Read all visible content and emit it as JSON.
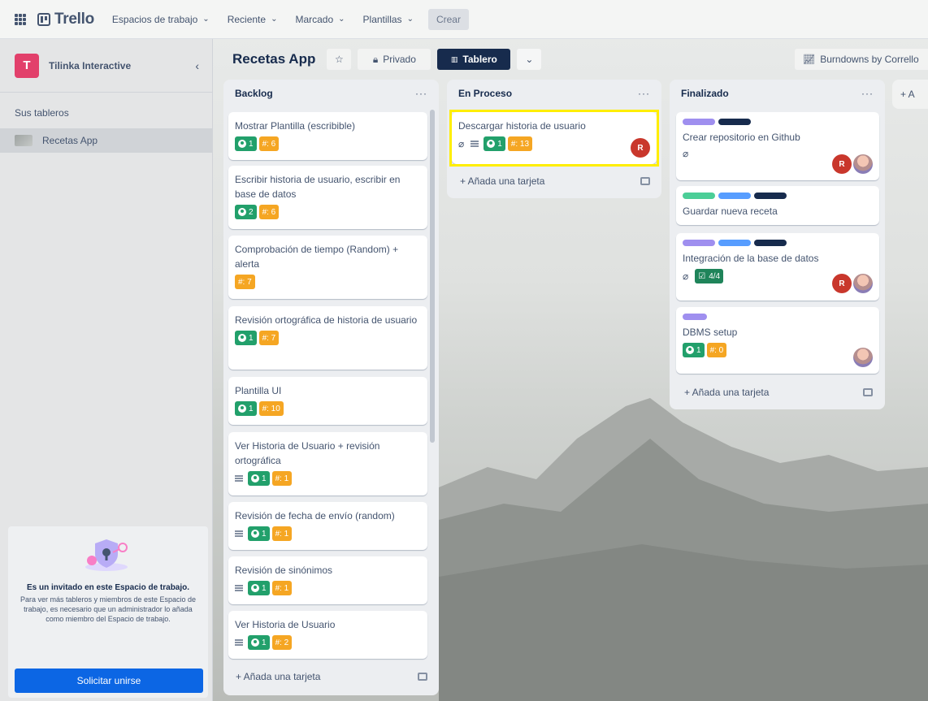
{
  "topbar": {
    "logo": "Trello",
    "nav": [
      "Espacios de trabajo",
      "Reciente",
      "Marcado",
      "Plantillas"
    ],
    "create": "Crear"
  },
  "sidebar": {
    "workspace_initial": "T",
    "workspace_name": "Tilinka Interactive",
    "boards_label": "Sus tableros",
    "boards": [
      "Recetas App"
    ],
    "guest_title": "Es un invitado en este Espacio de trabajo.",
    "guest_desc": "Para ver más tableros y miembros de este Espacio de trabajo, es necesario que un administrador lo añada como miembro del Espacio de trabajo.",
    "join_button": "Solicitar unirse"
  },
  "board": {
    "title": "Recetas App",
    "visibility": "Privado",
    "view": "Tablero",
    "burndown": "Burndowns by Corrello",
    "add_list": "+ A"
  },
  "lists": {
    "backlog": {
      "title": "Backlog",
      "cards": [
        {
          "title": "Mostrar Plantilla (escribible)",
          "points": "1",
          "estimate": "#: 6"
        },
        {
          "title": "Escribir historia de usuario, escribir en base de datos",
          "points": "2",
          "estimate": "#: 6"
        },
        {
          "title": "Comprobación de tiempo (Random) + alerta",
          "estimate": "#: 7"
        },
        {
          "title": "Revisión ortográfica de historia de usuario",
          "points": "1",
          "estimate": "#: 7"
        },
        {
          "title": "Plantilla UI",
          "points": "1",
          "estimate": "#: 10"
        },
        {
          "title": "Ver Historia de Usuario + revisión ortográfica",
          "points": "1",
          "estimate": "#: 1"
        },
        {
          "title": "Revisión de fecha de envío (random)",
          "points": "1",
          "estimate": "#: 1"
        },
        {
          "title": "Revisión de sinónimos",
          "points": "1",
          "estimate": "#: 1"
        },
        {
          "title": "Ver Historia de Usuario",
          "points": "1",
          "estimate": "#: 2"
        }
      ],
      "add_card": "+ Añada una tarjeta"
    },
    "en_proceso": {
      "title": "En Proceso",
      "cards": [
        {
          "title": "Descargar historia de usuario",
          "points": "1",
          "estimate": "#: 13",
          "member": "R"
        }
      ],
      "add_card": "+ Añada una tarjeta"
    },
    "finalizado": {
      "title": "Finalizado",
      "cards": [
        {
          "title": "Crear repositorio en Github",
          "member": "R"
        },
        {
          "title": "Guardar nueva receta"
        },
        {
          "title": "Integración de la base de datos",
          "checklist": "4/4",
          "member": "R"
        },
        {
          "title": "DBMS setup",
          "points": "1",
          "estimate": "#: 0"
        }
      ],
      "add_card": "+ Añada una tarjeta"
    }
  },
  "colors": {
    "accent": "#0c66e4",
    "highlight": "#ffee00",
    "badge_green": "#22a06b",
    "badge_orange": "#f5a623"
  }
}
